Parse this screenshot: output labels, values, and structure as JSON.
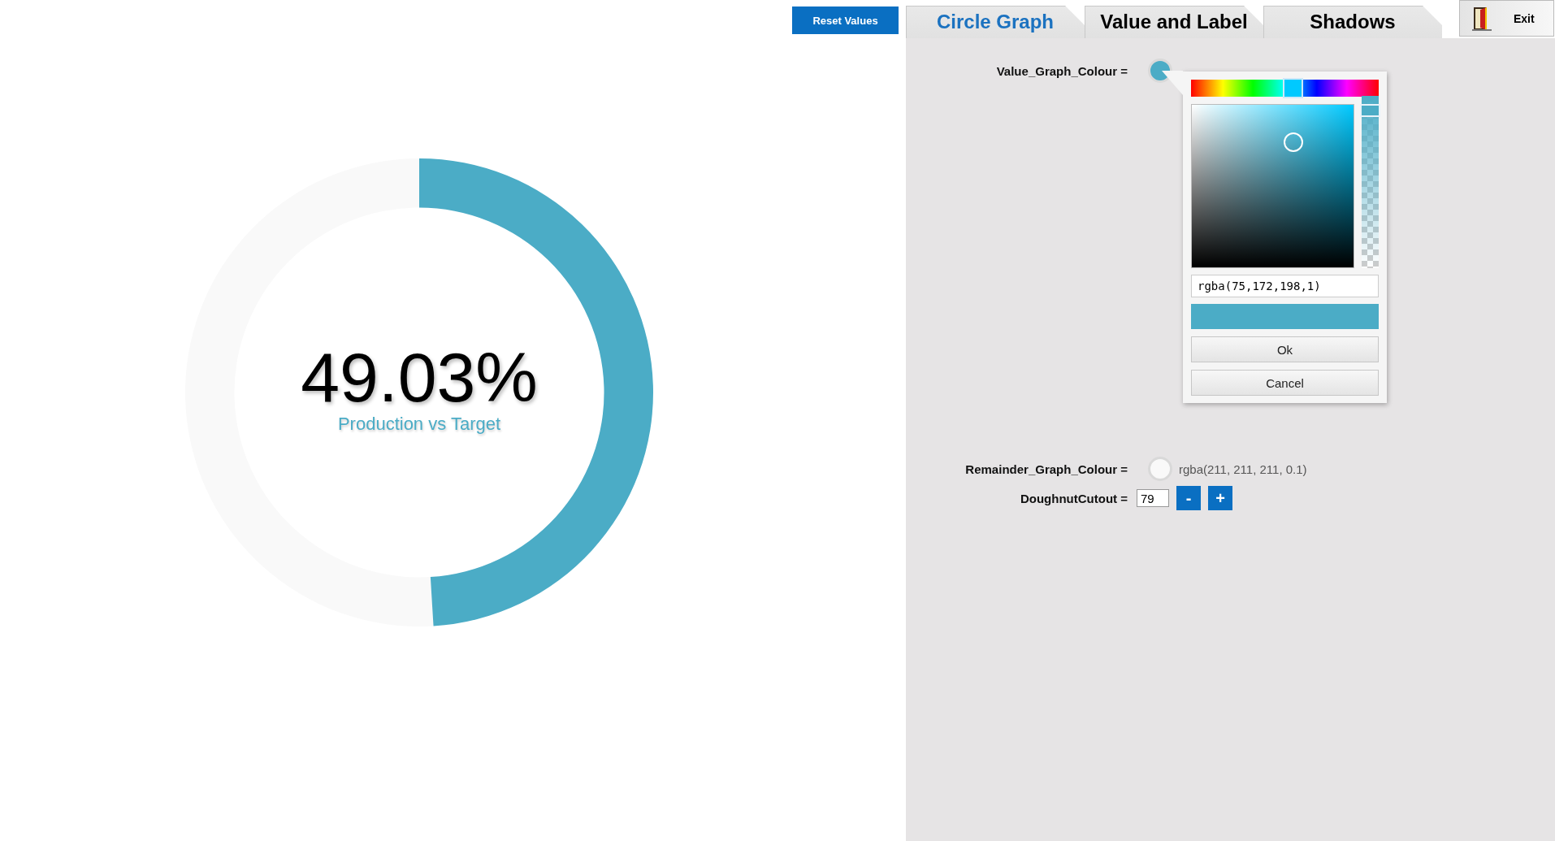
{
  "reset_button": "Reset Values",
  "tabs": [
    {
      "label": "Circle Graph",
      "selected": true
    },
    {
      "label": "Value and Label",
      "selected": false
    },
    {
      "label": "Shadows",
      "selected": false
    }
  ],
  "exit_button": "Exit",
  "donut": {
    "value_label": "49.03%",
    "caption": "Production vs Target",
    "chart_data": {
      "type": "donut",
      "values": [
        49.03,
        50.97
      ]
    }
  },
  "settings": [
    {
      "kind": "colour",
      "label": "Value_Graph_Colour =",
      "color": "#4bacc6",
      "picker": {
        "hue": {
          "level": 0.535
        },
        "alpha": {
          "level": 1
        },
        "input_value": "rgba(75,172,198,1)",
        "buttons": [
          "Ok",
          "Cancel"
        ]
      }
    },
    {
      "kind": "colour",
      "label": "Remainder_Graph_Colour =",
      "value": "rgba(211, 211, 211, 0.1)",
      "color": "#f9f9f9"
    },
    {
      "kind": "number",
      "label": "DoughnutCutout =",
      "value": "79",
      "buttons": [
        "-",
        "+"
      ]
    }
  ]
}
